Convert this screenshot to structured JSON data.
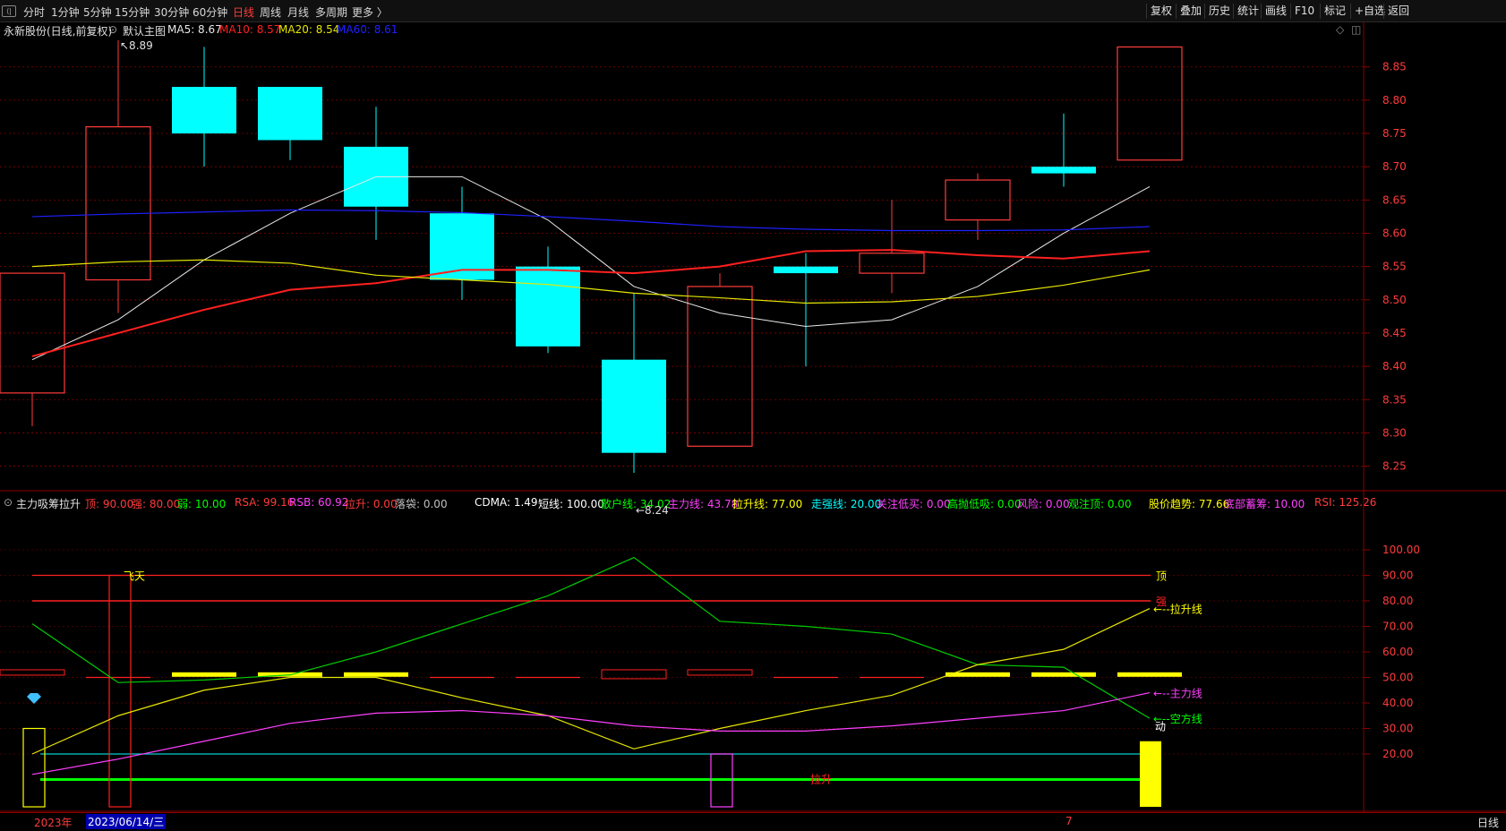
{
  "toolbar": {
    "periods": [
      "分时",
      "1分钟",
      "5分钟",
      "15分钟",
      "30分钟",
      "60分钟",
      "日线",
      "周线",
      "月线",
      "多周期",
      "更多 〉"
    ],
    "active_period": "日线",
    "right_buttons": [
      "复权",
      "叠加",
      "历史",
      "统计",
      "画线",
      "F10",
      "标记",
      "+自选",
      "返回"
    ]
  },
  "main_header": {
    "stock": "永新股份(日线,前复权)",
    "template": "默认主图",
    "ma5": "MA5: 8.67",
    "ma10": "MA10: 8.57",
    "ma20": "MA20: 8.54",
    "ma60": "MA60: 8.61"
  },
  "colors": {
    "up": "#ff3b3b",
    "down": "#00ffff",
    "ma5": "#e8e8e8",
    "ma10": "#ff2020",
    "ma20": "#e6e600",
    "ma60": "#2020ff",
    "grid": "#8b0000",
    "axis_text": "#ff3b3b"
  },
  "price_axis": [
    "8.85",
    "8.80",
    "8.75",
    "8.70",
    "8.65",
    "8.60",
    "8.55",
    "8.50",
    "8.45",
    "8.40",
    "8.35",
    "8.30",
    "8.25"
  ],
  "price_annotations": {
    "high": "8.89",
    "low": "8.24"
  },
  "chart_data": {
    "type": "candlestick",
    "candles": [
      {
        "o": 8.36,
        "c": 8.54,
        "h": 8.54,
        "l": 8.31
      },
      {
        "o": 8.53,
        "c": 8.76,
        "h": 8.89,
        "l": 8.48
      },
      {
        "o": 8.82,
        "c": 8.75,
        "h": 8.88,
        "l": 8.7
      },
      {
        "o": 8.82,
        "c": 8.74,
        "h": 8.82,
        "l": 8.71
      },
      {
        "o": 8.73,
        "c": 8.64,
        "h": 8.79,
        "l": 8.59
      },
      {
        "o": 8.63,
        "c": 8.53,
        "h": 8.67,
        "l": 8.5
      },
      {
        "o": 8.55,
        "c": 8.43,
        "h": 8.58,
        "l": 8.42
      },
      {
        "o": 8.41,
        "c": 8.27,
        "h": 8.51,
        "l": 8.24
      },
      {
        "o": 8.28,
        "c": 8.52,
        "h": 8.54,
        "l": 8.28
      },
      {
        "o": 8.55,
        "c": 8.54,
        "h": 8.57,
        "l": 8.4
      },
      {
        "o": 8.54,
        "c": 8.57,
        "h": 8.65,
        "l": 8.51
      },
      {
        "o": 8.62,
        "c": 8.68,
        "h": 8.69,
        "l": 8.59
      },
      {
        "o": 8.7,
        "c": 8.69,
        "h": 8.78,
        "l": 8.67
      },
      {
        "o": 8.71,
        "c": 8.88,
        "h": 8.88,
        "l": 8.71
      }
    ],
    "series": [
      {
        "name": "MA5",
        "values": [
          8.41,
          8.47,
          8.56,
          8.63,
          8.685,
          8.685,
          8.62,
          8.52,
          8.48,
          8.46,
          8.47,
          8.52,
          8.6,
          8.67
        ]
      },
      {
        "name": "MA10",
        "values": [
          8.415,
          8.45,
          8.485,
          8.515,
          8.525,
          8.545,
          8.545,
          8.54,
          8.55,
          8.573,
          8.575,
          8.567,
          8.562,
          8.573
        ]
      },
      {
        "name": "MA20",
        "values": [
          8.55,
          8.557,
          8.56,
          8.555,
          8.537,
          8.53,
          8.523,
          8.51,
          8.503,
          8.495,
          8.497,
          8.505,
          8.522,
          8.545
        ]
      },
      {
        "name": "MA60",
        "values": [
          8.625,
          8.629,
          8.632,
          8.635,
          8.634,
          8.631,
          8.625,
          8.618,
          8.61,
          8.606,
          8.604,
          8.604,
          8.605,
          8.61
        ]
      }
    ],
    "ylim": [
      8.22,
      8.9
    ]
  },
  "indicator": {
    "name": "主力吸筹拉升",
    "params": [
      {
        "t": "顶: 90.00",
        "c": "#ff3b3b"
      },
      {
        "t": "强: 80.00",
        "c": "#ff3b3b"
      },
      {
        "t": "弱: 10.00",
        "c": "#00ff00"
      },
      {
        "t": "RSA: 99.16",
        "c": "#ff3b3b"
      },
      {
        "t": "RSB: 60.92",
        "c": "#ff40ff"
      },
      {
        "t": "拉升: 0.00",
        "c": "#ff3b3b"
      },
      {
        "t": "落袋: 0.00",
        "c": "#c0c0c0"
      },
      {
        "t": "CDMA: 1.49",
        "c": "#ffffff"
      },
      {
        "t": "短线: 100.00",
        "c": "#ffffff"
      },
      {
        "t": "散户线: 34.02",
        "c": "#00ff00"
      },
      {
        "t": "主力线: 43.78",
        "c": "#ff40ff"
      },
      {
        "t": "拉升线: 77.00",
        "c": "#ffff00"
      },
      {
        "t": "走强线: 20.00",
        "c": "#00ffff"
      },
      {
        "t": "关注低买: 0.00",
        "c": "#ff40ff"
      },
      {
        "t": "高抛低吸: 0.00",
        "c": "#00ff00"
      },
      {
        "t": "风险: 0.00",
        "c": "#ff40ff"
      },
      {
        "t": "观注顶: 0.00",
        "c": "#00ff00"
      },
      {
        "t": "股价趋势: 77.66",
        "c": "#ffff00"
      },
      {
        "t": "底部蓄筹: 10.00",
        "c": "#ff40ff"
      },
      {
        "t": "RSI: 125.26",
        "c": "#ff3b3b"
      }
    ],
    "axis": [
      "100.00",
      "90.00",
      "80.00",
      "70.00",
      "60.00",
      "50.00",
      "40.00",
      "30.00",
      "20.00"
    ],
    "labels": {
      "top": "顶",
      "strong": "强",
      "lift": "拉升线",
      "main": "主力线",
      "retail": "空方线",
      "move": "动",
      "feitian": "飞天",
      "lashen": "拉升"
    },
    "lift_line": [
      20,
      35,
      45,
      50,
      50,
      42,
      35,
      22,
      30,
      37,
      43,
      55,
      61,
      77
    ],
    "main_line": [
      12,
      18,
      25,
      32,
      36,
      37,
      35,
      31,
      29,
      29,
      31,
      34,
      37,
      44
    ],
    "retail_line": [
      71,
      48,
      49,
      51,
      60,
      71,
      82,
      97,
      72,
      70,
      67,
      55,
      54,
      34
    ]
  },
  "status": {
    "year": "2023年",
    "date": "2023/06/14/三",
    "month": "7",
    "period": "日线"
  }
}
